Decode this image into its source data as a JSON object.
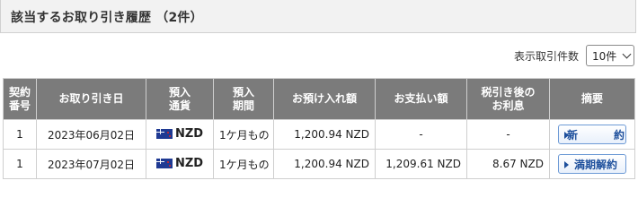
{
  "header": {
    "title": "該当するお取り引き履歴 （2件）"
  },
  "filter": {
    "label": "表示取引件数",
    "selected": "10件"
  },
  "table": {
    "columns": [
      "契約\n番号",
      "お取り引き日",
      "預入\n通貨",
      "預入\n期間",
      "お預け入れ額",
      "お支払い額",
      "税引き後の\nお利息",
      "摘要"
    ],
    "rows": [
      {
        "contract_no": "1",
        "date": "2023年06月02日",
        "currency": "NZD",
        "flag_icon": "nz-flag-icon",
        "period": "1ケ月もの",
        "deposit": "1,200.94 NZD",
        "payment": "-",
        "interest": "-",
        "action": "新　約"
      },
      {
        "contract_no": "1",
        "date": "2023年07月02日",
        "currency": "NZD",
        "flag_icon": "nz-flag-icon",
        "period": "1ケ月もの",
        "deposit": "1,200.94 NZD",
        "payment": "1,209.61 NZD",
        "interest": "8.67 NZD",
        "action": "満期解約"
      }
    ]
  },
  "colors": {
    "header_bg": "#7b7b7b",
    "button_text": "#1d4f9c",
    "button_border": "#6d9ad6"
  }
}
